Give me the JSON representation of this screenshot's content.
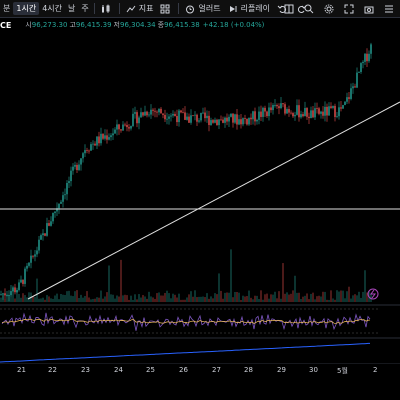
{
  "toolbar": {
    "items_left": [
      {
        "label": "분",
        "active": false
      },
      {
        "label": "1시간",
        "active": true
      },
      {
        "label": "4시간",
        "active": false
      },
      {
        "label": "날",
        "active": false
      },
      {
        "label": "주",
        "active": false
      }
    ],
    "indicators_label": "지표",
    "alert_label": "얼러트",
    "replay_label": "리플레이"
  },
  "ohlc": {
    "symbol": "CE",
    "open_label": "시",
    "open": "96,273.30",
    "high_label": "고",
    "high": "96,415.39",
    "low_label": "저",
    "low": "96,304.34",
    "close_label": "종",
    "close": "96,415.38",
    "change": "+42.18 (+0.04%)"
  },
  "x_axis": {
    "ticks": [
      "21",
      "22",
      "23",
      "24",
      "25",
      "26",
      "27",
      "28",
      "29",
      "30",
      "5월",
      "2"
    ]
  },
  "colors": {
    "up": "#26a69a",
    "down": "#ef5350",
    "background": "#000000",
    "rsi_line": "#7e57c2",
    "rsi_ma": "#f7c35c",
    "blue_line": "#2962ff"
  },
  "chart_data": {
    "type": "candlestick",
    "candle_closes_trend": [
      {
        "day": "21",
        "close": 0.05
      },
      {
        "day": "22",
        "close": 0.32
      },
      {
        "day": "23",
        "close": 0.6
      },
      {
        "day": "24",
        "close": 0.67
      },
      {
        "day": "25",
        "close": 0.75
      },
      {
        "day": "26",
        "close": 0.72
      },
      {
        "day": "27",
        "close": 0.71
      },
      {
        "day": "28",
        "close": 0.71
      },
      {
        "day": "29",
        "close": 0.76
      },
      {
        "day": "30",
        "close": 0.73
      },
      {
        "day": "5월",
        "close": 0.75
      },
      {
        "day": "2",
        "close": 1.0
      }
    ],
    "horizontal_line": true,
    "trend_line": true,
    "indicators": [
      "volume",
      "rsi",
      "cumulative line"
    ]
  }
}
